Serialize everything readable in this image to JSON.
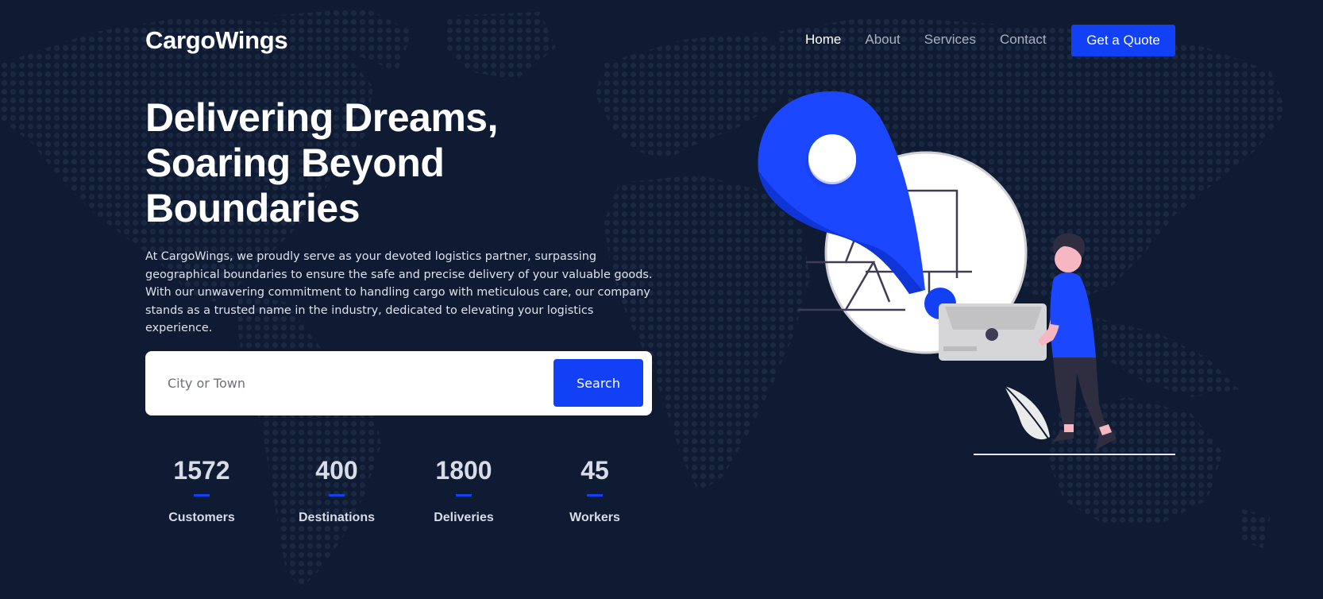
{
  "header": {
    "logo": "CargoWings",
    "nav": [
      {
        "label": "Home",
        "active": true
      },
      {
        "label": "About",
        "active": false
      },
      {
        "label": "Services",
        "active": false
      },
      {
        "label": "Contact",
        "active": false
      }
    ],
    "cta_label": "Get a Quote"
  },
  "hero": {
    "title_lines": [
      "Delivering Dreams,",
      "Soaring Beyond",
      "Boundaries"
    ],
    "description": "At CargoWings, we proudly serve as your devoted logistics partner, surpassing geographical boundaries to ensure the safe and precise delivery of your valuable goods. With our unwavering commitment to handling cargo with meticulous care, our company stands as a trusted name in the industry, dedicated to elevating your logistics experience."
  },
  "search": {
    "placeholder": "City or Town",
    "value": "",
    "button_label": "Search"
  },
  "stats": [
    {
      "value": "1572",
      "label": "Customers"
    },
    {
      "value": "400",
      "label": "Destinations"
    },
    {
      "value": "1800",
      "label": "Deliveries"
    },
    {
      "value": "45",
      "label": "Workers"
    }
  ],
  "colors": {
    "background": "#0f1b33",
    "accent": "#1140f5",
    "text_muted": "#a8b0c0"
  },
  "illustration": {
    "icons": [
      "world-map-dots-background",
      "location-pin-icon",
      "map-circle",
      "package-box-icon",
      "delivery-person",
      "plant-leaf"
    ]
  }
}
